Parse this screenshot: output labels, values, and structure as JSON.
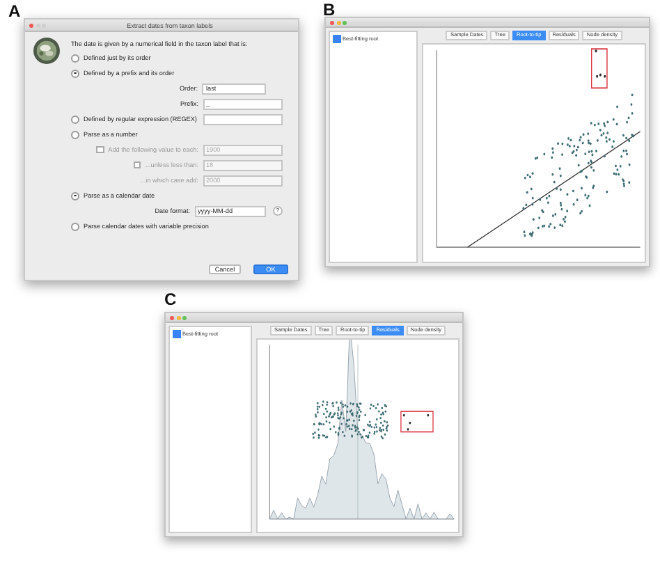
{
  "panel_a": {
    "label": "A",
    "dialog": {
      "title": "Extract dates from taxon labels",
      "intro": "The date is given by a numerical field in the taxon label that is:",
      "options": [
        {
          "label": "Defined just by its order",
          "selected": false
        },
        {
          "label": "Defined by a prefix and its order",
          "selected": true,
          "fields": [
            {
              "kind": "select",
              "label": "Order:",
              "value": "last",
              "disabled": false
            },
            {
              "kind": "text",
              "label": "Prefix:",
              "value": "_",
              "disabled": false
            }
          ]
        },
        {
          "label": "Defined by regular expression (REGEX)",
          "selected": false,
          "inline_field": true
        },
        {
          "label": "Parse as a number",
          "selected": false,
          "fields": [
            {
              "kind": "check-text",
              "label": "Add the following value to each:",
              "placeholder": "1900",
              "checked": false,
              "disabled": true
            },
            {
              "kind": "check-text",
              "label": "...unless less than:",
              "placeholder": "18",
              "checked": false,
              "disabled": true
            },
            {
              "kind": "text",
              "label": "...in which case add:",
              "placeholder": "2000",
              "disabled": true
            }
          ]
        },
        {
          "label": "Parse as a calendar date",
          "selected": true,
          "fields": [
            {
              "kind": "help-text",
              "label": "Date format:",
              "value": "yyyy-MM-dd",
              "help": "?",
              "disabled": false
            }
          ]
        },
        {
          "label": "Parse calendar dates with variable precision",
          "selected": false
        }
      ],
      "buttons": [
        {
          "label": "Cancel",
          "kind": "secondary"
        },
        {
          "label": "OK",
          "kind": "primary"
        }
      ]
    }
  },
  "panel_b": {
    "label": "B",
    "window": {
      "root_option": {
        "label": "Best-fitting root",
        "checked": true
      },
      "tabs": [
        {
          "label": "Sample Dates",
          "selected": false
        },
        {
          "label": "Tree",
          "selected": false
        },
        {
          "label": "Root-to-tip",
          "selected": true
        },
        {
          "label": "Residuals",
          "selected": false
        },
        {
          "label": "Node density",
          "selected": false
        }
      ],
      "plot": {
        "kind": "regression"
      }
    }
  },
  "panel_c": {
    "label": "C",
    "window": {
      "root_option": {
        "label": "Best-fitting root",
        "checked": true
      },
      "tabs": [
        {
          "label": "Sample Dates",
          "selected": false
        },
        {
          "label": "Tree",
          "selected": false
        },
        {
          "label": "Root-to-tip",
          "selected": false
        },
        {
          "label": "Residuals",
          "selected": true
        },
        {
          "label": "Node density",
          "selected": false
        }
      ],
      "plot": {
        "kind": "residuals"
      }
    }
  }
}
